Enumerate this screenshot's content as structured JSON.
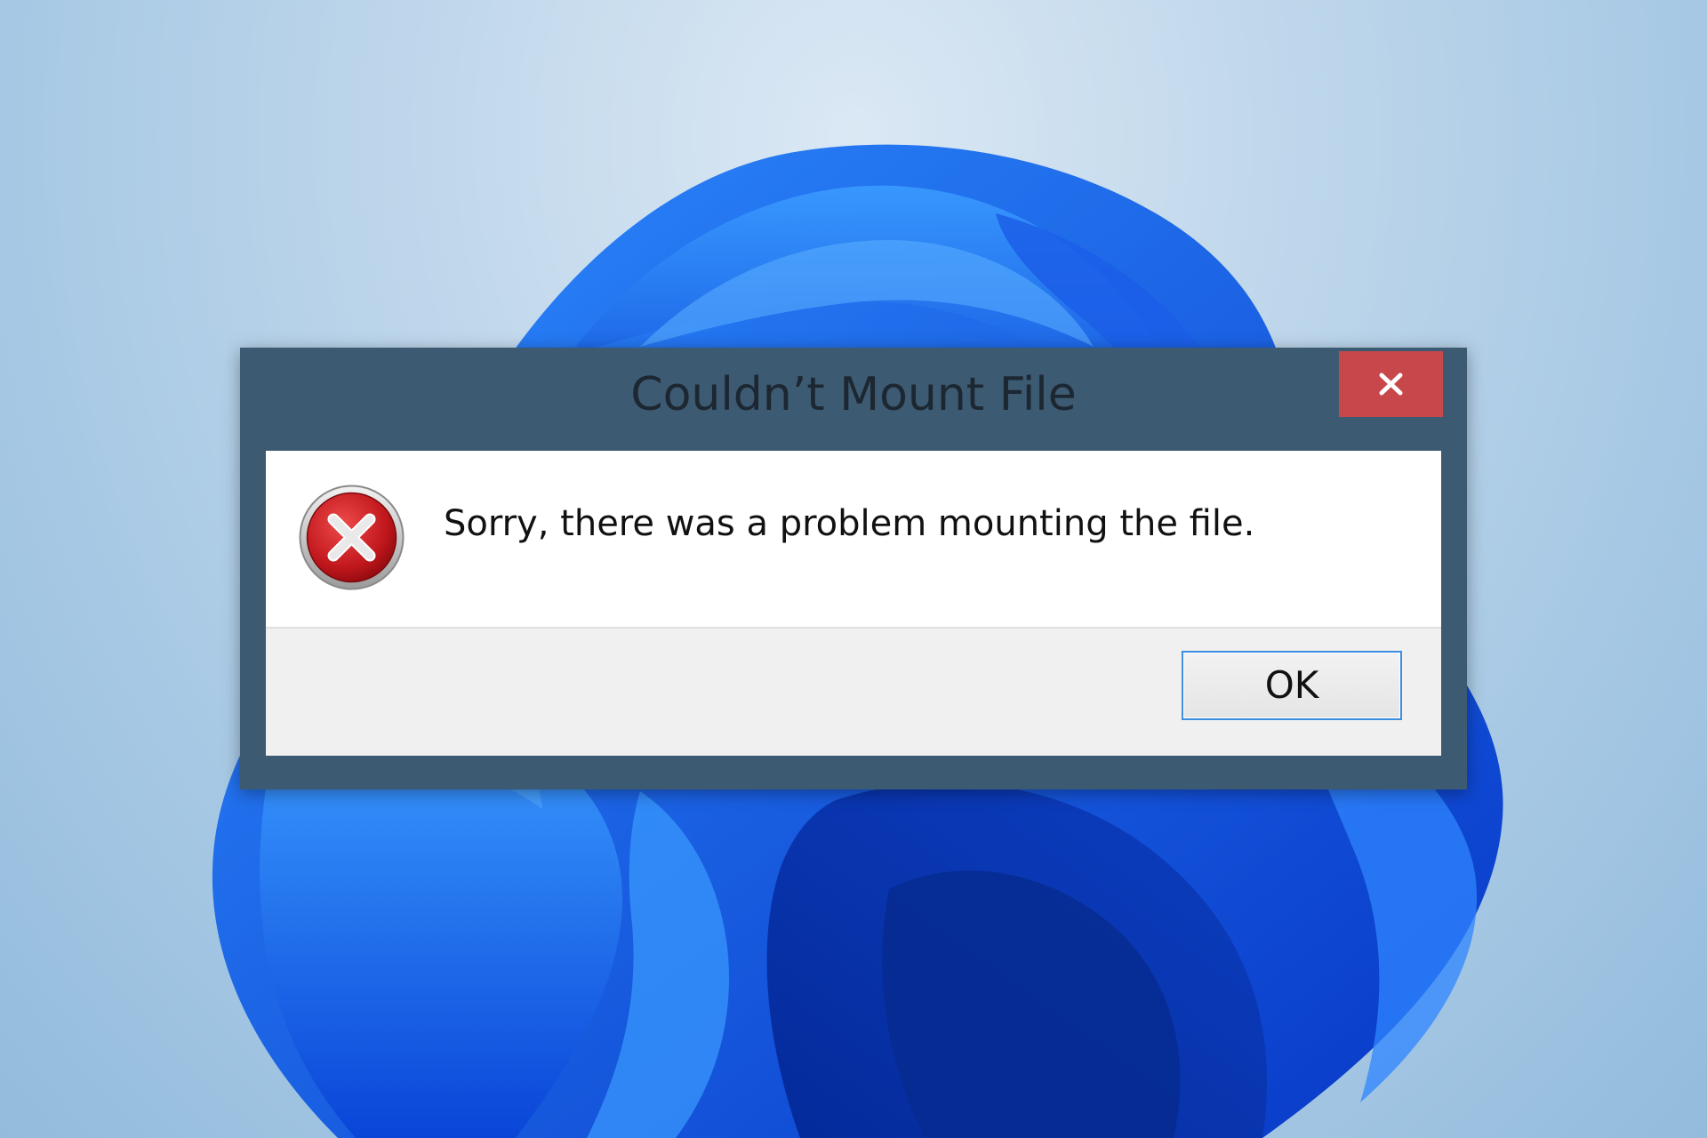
{
  "dialog": {
    "title": "Couldn’t Mount File",
    "message": "Sorry, there was a problem mounting the file.",
    "ok_label": "OK",
    "close_icon": "close-icon",
    "status_icon": "error-icon"
  },
  "colors": {
    "titlebar": "#3d5a73",
    "close_button": "#c7474b",
    "error_icon": "#c0171c",
    "ok_border": "#3b8ee0",
    "wallpaper_bloom": "#1266f1"
  }
}
